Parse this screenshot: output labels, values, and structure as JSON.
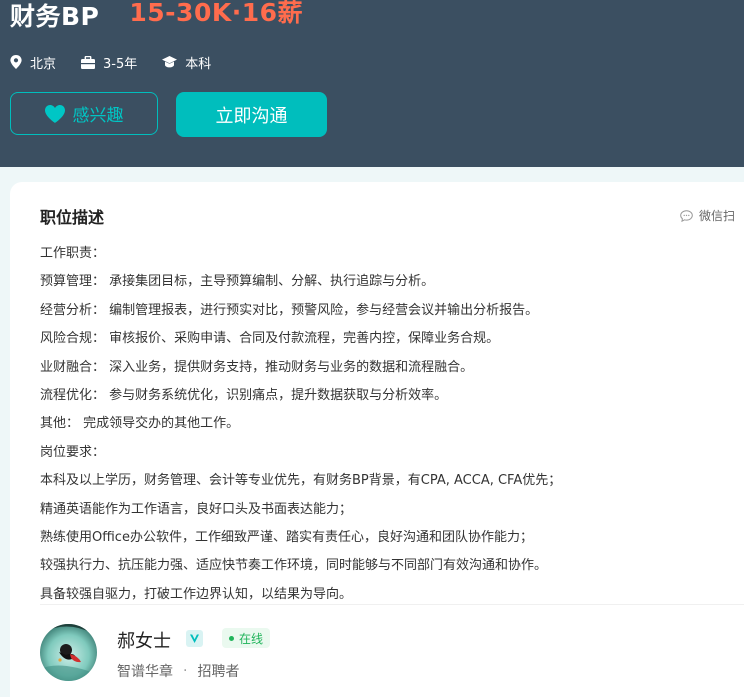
{
  "job": {
    "title": "财务BP",
    "salary": "15-30K·16薪",
    "location": "北京",
    "experience": "3-5年",
    "education": "本科"
  },
  "actions": {
    "interest_label": "感兴趣",
    "chat_label": "立即沟通"
  },
  "description": {
    "section_title": "职位描述",
    "wechat_label": "微信扫",
    "lines": [
      "工作职责：",
      "预算管理： 承接集团目标，主导预算编制、分解、执行追踪与分析。",
      "经营分析： 编制管理报表，进行预实对比，预警风险，参与经营会议并输出分析报告。",
      "风险合规： 审核报价、采购申请、合同及付款流程，完善内控，保障业务合规。",
      "业财融合： 深入业务，提供财务支持，推动财务与业务的数据和流程融合。",
      "流程优化： 参与财务系统优化，识别痛点，提升数据获取与分析效率。",
      "其他： 完成领导交办的其他工作。",
      "岗位要求：",
      "本科及以上学历，财务管理、会计等专业优先，有财务BP背景，有CPA, ACCA, CFA优先；",
      "精通英语能作为工作语言，良好口头及书面表达能力；",
      "熟练使用Office办公软件，工作细致严谨、踏实有责任心，良好沟通和团队协作能力；",
      "较强执行力、抗压能力强、适应快节奏工作环境，同时能够与不同部门有效沟通和协作。",
      "具备较强自驱力，打破工作边界认知，以结果为导向。"
    ]
  },
  "recruiter": {
    "name": "郝女士",
    "status": "在线",
    "company": "智谱华章",
    "separator": "·",
    "role": "招聘者"
  },
  "colors": {
    "header_bg": "#3b4f61",
    "salary": "#ff6c4d",
    "accent": "#00bebd",
    "online": "#21b45b"
  },
  "icons": [
    "location-icon",
    "briefcase-icon",
    "graduation-cap-icon",
    "heart-icon",
    "chat-bubble-icon",
    "verified-v-icon"
  ]
}
